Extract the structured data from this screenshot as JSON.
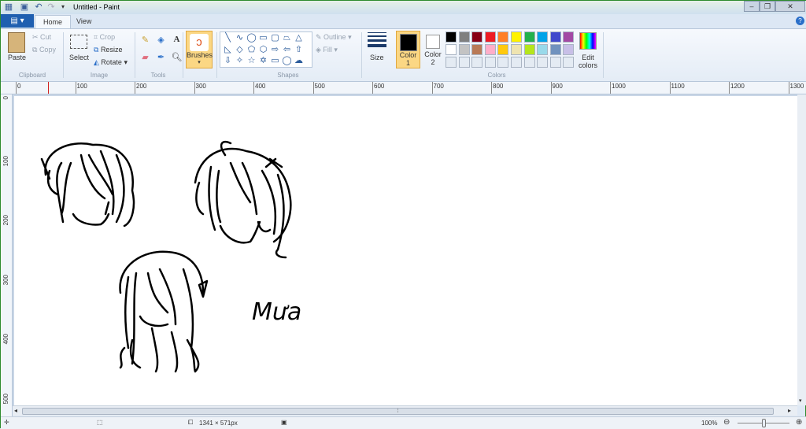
{
  "window": {
    "title": "Untitled - Paint"
  },
  "tabs": [
    {
      "label": "Home",
      "active": true
    },
    {
      "label": "View",
      "active": false
    }
  ],
  "clipboard": {
    "paste": "Paste",
    "cut": "Cut",
    "copy": "Copy",
    "group": "Clipboard"
  },
  "image": {
    "select": "Select",
    "crop": "Crop",
    "resize": "Resize",
    "rotate": "Rotate",
    "group": "Image"
  },
  "tools": {
    "group": "Tools"
  },
  "brushes": {
    "label": "Brushes"
  },
  "shapes": {
    "outline": "Outline",
    "fill": "Fill",
    "group": "Shapes"
  },
  "size": {
    "label": "Size"
  },
  "colors": {
    "color1": "Color",
    "color1_num": "1",
    "color2": "Color",
    "color2_num": "2",
    "edit": "Edit",
    "edit2": "colors",
    "group": "Colors",
    "color1_value": "#000000",
    "color2_value": "#ffffff",
    "palette_row1": [
      "#000000",
      "#7f7f7f",
      "#880015",
      "#ed1c24",
      "#ff7f27",
      "#fff200",
      "#22b14c",
      "#00a2e8",
      "#3f48cc",
      "#a349a4"
    ],
    "palette_row2": [
      "#ffffff",
      "#c3c3c3",
      "#b97a57",
      "#ffaec9",
      "#ffc90e",
      "#efe4b0",
      "#b5e61d",
      "#99d9ea",
      "#7092be",
      "#c8bfe7"
    ]
  },
  "ruler": {
    "top": [
      "0",
      "100",
      "200",
      "300",
      "400",
      "500",
      "600",
      "700",
      "800",
      "900",
      "1000",
      "1100",
      "1200",
      "1300"
    ],
    "left": [
      "0",
      "100",
      "200",
      "300",
      "400",
      "500"
    ]
  },
  "canvas": {
    "handwriting": "Mưa"
  },
  "status": {
    "image_size": "1341 × 571px",
    "zoom": "100%",
    "zoom_fraction": 0.5
  }
}
